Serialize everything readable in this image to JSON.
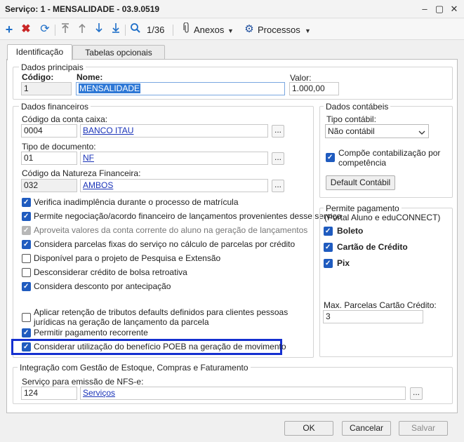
{
  "window": {
    "title": "Serviço: 1 - MENSALIDADE - 03.9.0519",
    "minimize": "–",
    "restore": "▢",
    "close": "✕"
  },
  "toolbar": {
    "add_icon": "plus-icon",
    "delete_icon": "x-icon",
    "refresh_icon": "refresh-icon",
    "first_icon": "first-icon",
    "prev_icon": "up-arrow-icon",
    "next_icon": "down-arrow-icon",
    "last_icon": "last-icon",
    "search_icon": "search-icon",
    "record_position": "1/36",
    "attachments_label": "Anexos",
    "processes_label": "Processos"
  },
  "tabs": [
    "Identificação",
    "Tabelas opcionais"
  ],
  "dados_principais": {
    "legend": "Dados principais",
    "codigo_label": "Código:",
    "codigo_value": "1",
    "nome_label": "Nome:",
    "nome_value": "MENSALIDADE",
    "valor_label": "Valor:",
    "valor_value": "1.000,00"
  },
  "dados_financeiros": {
    "legend": "Dados financeiros",
    "conta_caixa_label": "Código da conta caixa:",
    "conta_caixa_code": "0004",
    "conta_caixa_name": "BANCO ITAU",
    "tipo_doc_label": "Tipo de documento:",
    "tipo_doc_code": "01",
    "tipo_doc_name": "NF",
    "natureza_label": "Código da Natureza Financeira:",
    "natureza_code": "032",
    "natureza_name": "AMBOS",
    "lookup_label": "...",
    "checkboxes": [
      {
        "label": "Verifica inadimplência durante o processo de matrícula",
        "state": "on"
      },
      {
        "label": "Permite negociação/acordo financeiro de lançamentos provenientes desse serviço",
        "state": "on"
      },
      {
        "label": "Aproveita valores da conta corrente do aluno na geração de lançamentos",
        "state": "disabled"
      },
      {
        "label": "Considera parcelas fixas do serviço no cálculo de parcelas por crédito",
        "state": "on"
      },
      {
        "label": "Disponível para o projeto de Pesquisa e Extensão",
        "state": "off"
      },
      {
        "label": "Desconsiderar crédito de bolsa retroativa",
        "state": "off"
      },
      {
        "label": "Considera desconto por antecipação",
        "state": "on"
      },
      {
        "label": "Aplicar retenção de tributos defaults definidos para clientes pessoas jurídicas na geração de lançamento da parcela",
        "state": "off"
      },
      {
        "label": "Permitir pagamento recorrente",
        "state": "on"
      },
      {
        "label": "Considerar utilização do benefício POEB na geração de movimento",
        "state": "on"
      }
    ]
  },
  "dados_contabeis": {
    "legend": "Dados contábeis",
    "tipo_label": "Tipo contábil:",
    "tipo_value": "Não contábil",
    "compoe_label": "Compõe contabilização por competência",
    "default_button": "Default Contábil"
  },
  "permite_pagamento": {
    "legend": "Permite pagamento",
    "sublegend": "(Portal Aluno e eduCONNECT)",
    "options": [
      "Boleto",
      "Cartão de Crédito",
      "Pix"
    ],
    "max_parcelas_label": "Max. Parcelas Cartão Crédito:",
    "max_parcelas_value": "3"
  },
  "integracao": {
    "legend": "Integração com Gestão de Estoque, Compras e Faturamento",
    "servico_label": "Serviço para emissão de NFS-e:",
    "servico_code": "124",
    "servico_name": "Serviços"
  },
  "footer": {
    "ok": "OK",
    "cancel": "Cancelar",
    "save": "Salvar"
  },
  "colors": {
    "accent": "#1f5bbf",
    "link": "#1a33b8",
    "highlight_border": "#1530d0"
  }
}
